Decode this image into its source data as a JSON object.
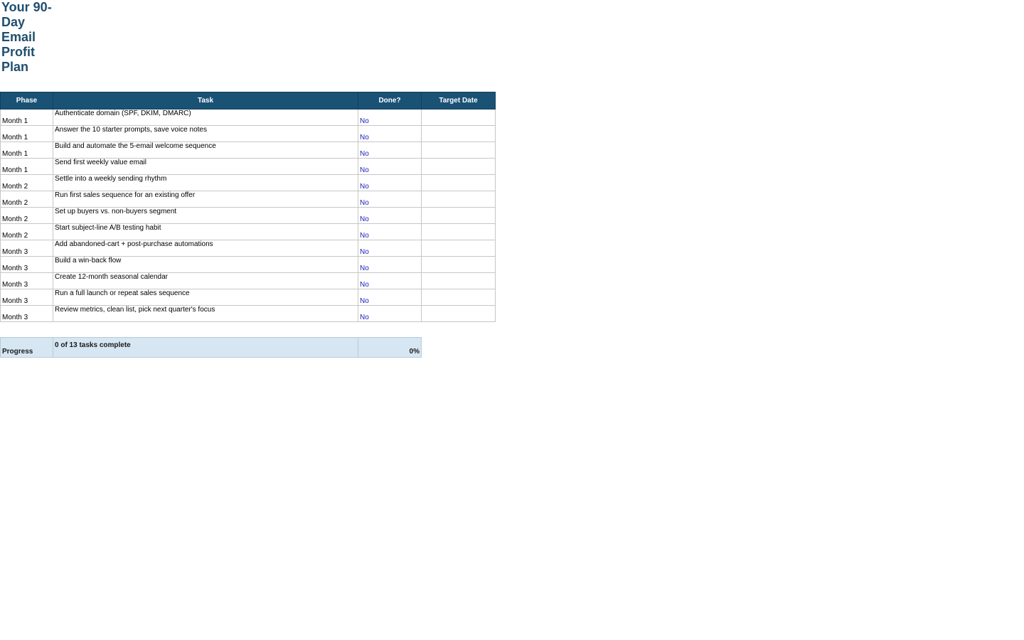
{
  "title": "Your 90-Day Email Profit Plan",
  "columns": {
    "phase": "Phase",
    "task": "Task",
    "done": "Done?",
    "target_date": "Target Date"
  },
  "rows": [
    {
      "phase": "Month 1",
      "task": "Authenticate domain (SPF, DKIM, DMARC)",
      "done": "No",
      "target_date": ""
    },
    {
      "phase": "Month 1",
      "task": "Answer the 10 starter prompts, save voice notes",
      "done": "No",
      "target_date": ""
    },
    {
      "phase": "Month 1",
      "task": "Build and automate the 5-email welcome sequence",
      "done": "No",
      "target_date": ""
    },
    {
      "phase": "Month 1",
      "task": "Send first weekly value email",
      "done": "No",
      "target_date": ""
    },
    {
      "phase": "Month 2",
      "task": "Settle into a weekly sending rhythm",
      "done": "No",
      "target_date": ""
    },
    {
      "phase": "Month 2",
      "task": "Run first sales sequence for an existing offer",
      "done": "No",
      "target_date": ""
    },
    {
      "phase": "Month 2",
      "task": "Set up buyers vs. non-buyers segment",
      "done": "No",
      "target_date": ""
    },
    {
      "phase": "Month 2",
      "task": "Start subject-line A/B testing habit",
      "done": "No",
      "target_date": ""
    },
    {
      "phase": "Month 3",
      "task": "Add abandoned-cart + post-purchase automations",
      "done": "No",
      "target_date": ""
    },
    {
      "phase": "Month 3",
      "task": "Build a win-back flow",
      "done": "No",
      "target_date": ""
    },
    {
      "phase": "Month 3",
      "task": "Create 12-month seasonal calendar",
      "done": "No",
      "target_date": ""
    },
    {
      "phase": "Month 3",
      "task": "Run a full launch or repeat sales sequence",
      "done": "No",
      "target_date": ""
    },
    {
      "phase": "Month 3",
      "task": "Review metrics, clean list, pick next quarter's focus",
      "done": "No",
      "target_date": ""
    }
  ],
  "progress": {
    "label": "Progress",
    "summary": "0 of 13 tasks complete",
    "percent": "0%"
  },
  "colors": {
    "header_bg": "#1a5276",
    "title": "#1f4e6e",
    "done_text": "#1a1ab8",
    "progress_bg": "#d6e6f2"
  }
}
